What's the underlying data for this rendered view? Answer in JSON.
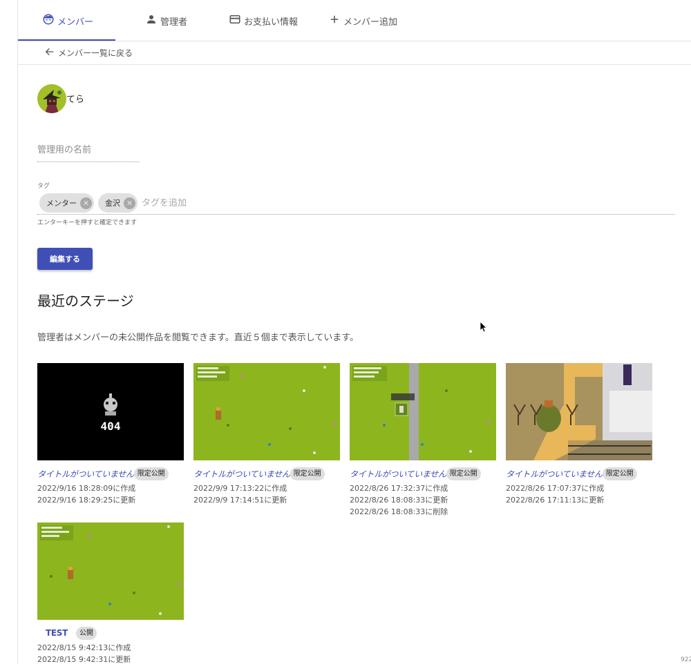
{
  "tabs": [
    {
      "label": "メンバー",
      "icon": "face-icon",
      "active": true
    },
    {
      "label": "管理者",
      "icon": "person-icon",
      "active": false
    },
    {
      "label": "お支払い情報",
      "icon": "credit-card-icon",
      "active": false
    },
    {
      "label": "メンバー追加",
      "icon": "plus-icon",
      "active": false
    }
  ],
  "back_link": "メンバー一覧に戻る",
  "member": {
    "name": "てら"
  },
  "name_field": {
    "placeholder": "管理用の名前",
    "value": ""
  },
  "tags": {
    "label": "タグ",
    "chips": [
      "メンター",
      "金沢"
    ],
    "input_placeholder": "タグを追加",
    "helper": "エンターキーを押すと確定できます"
  },
  "edit_button": "編集する",
  "stages": {
    "title": "最近のステージ",
    "description": "管理者はメンバーの未公開作品を閲覧できます。直近５個まで表示しています。",
    "cards": [
      {
        "title": "タイトルがついていません",
        "badge": "限定公開",
        "lines": [
          "2022/9/16 18:28:09に作成",
          "2022/9/16 18:29:25に更新"
        ],
        "thumb_text": "404"
      },
      {
        "title": "タイトルがついていません",
        "badge": "限定公開",
        "lines": [
          "2022/9/9 17:13:22に作成",
          "2022/9/9 17:14:51に更新"
        ]
      },
      {
        "title": "タイトルがついていません",
        "badge": "限定公開",
        "lines": [
          "2022/8/26 17:32:37に作成",
          "2022/8/26 18:08:33に更新",
          "2022/8/26 18:08:33に削除"
        ]
      },
      {
        "title": "タイトルがついていません",
        "badge": "限定公開",
        "lines": [
          "2022/8/26 17:07:37に作成",
          "2022/8/26 17:11:13に更新"
        ]
      },
      {
        "title": "TEST",
        "badge": "公開",
        "lines": [
          "2022/8/15 9:42:13に作成",
          "2022/8/15 9:42:31に更新"
        ]
      }
    ]
  },
  "corner_text": "922",
  "colors": {
    "accent": "#3f4fb5",
    "grass": "#8db51e",
    "sand": "#e8b75a"
  }
}
